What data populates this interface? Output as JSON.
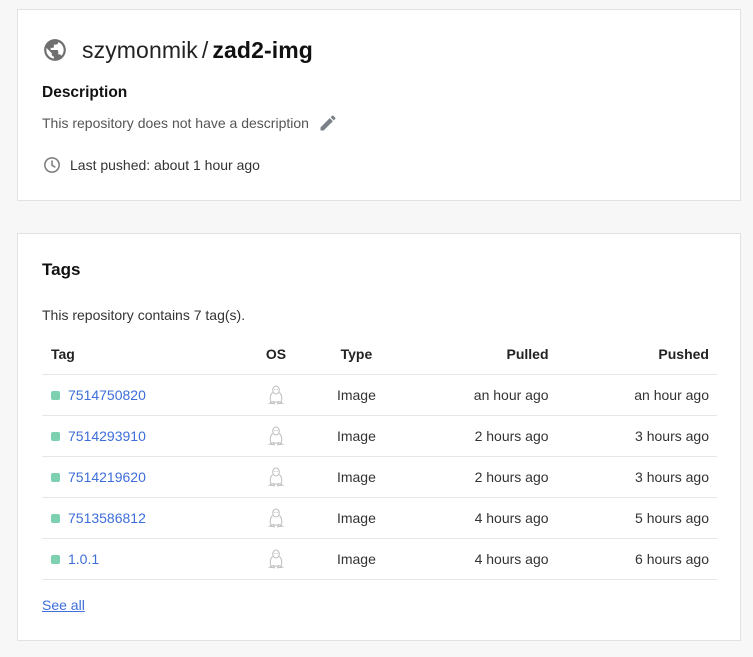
{
  "repository": {
    "owner": "szymonmik",
    "separator": "/",
    "name": "zad2-img",
    "description_heading": "Description",
    "description_text": "This repository does not have a description",
    "last_pushed": "Last pushed: about 1 hour ago",
    "icons": {
      "visibility": "globe-icon",
      "edit": "pencil-icon",
      "pushed": "clock-icon"
    }
  },
  "tags_section": {
    "heading": "Tags",
    "count_text": "This repository contains 7 tag(s).",
    "columns": {
      "tag": "Tag",
      "os": "OS",
      "type": "Type",
      "pulled": "Pulled",
      "pushed": "Pushed"
    },
    "rows": [
      {
        "tag": "7514750820",
        "os_icon": "linux-icon",
        "type": "Image",
        "pulled": "an hour ago",
        "pushed": "an hour ago"
      },
      {
        "tag": "7514293910",
        "os_icon": "linux-icon",
        "type": "Image",
        "pulled": "2 hours ago",
        "pushed": "3 hours ago"
      },
      {
        "tag": "7514219620",
        "os_icon": "linux-icon",
        "type": "Image",
        "pulled": "2 hours ago",
        "pushed": "3 hours ago"
      },
      {
        "tag": "7513586812",
        "os_icon": "linux-icon",
        "type": "Image",
        "pulled": "4 hours ago",
        "pushed": "5 hours ago"
      },
      {
        "tag": "1.0.1",
        "os_icon": "linux-icon",
        "type": "Image",
        "pulled": "4 hours ago",
        "pushed": "6 hours ago"
      }
    ],
    "see_all": "See all"
  },
  "colors": {
    "link": "#3d6ed9",
    "status_dot": "#7ed1b0",
    "icon_gray": "#888888"
  }
}
